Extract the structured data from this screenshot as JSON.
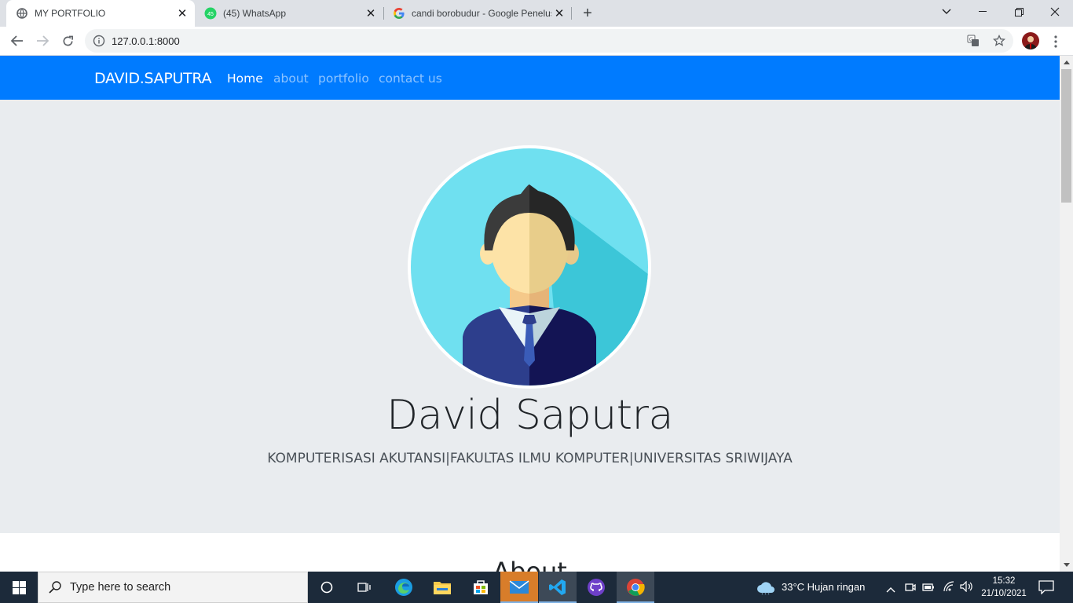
{
  "browser": {
    "tabs": [
      {
        "title": "MY PORTFOLIO",
        "favicon": "globe-icon",
        "active": true
      },
      {
        "title": "(45) WhatsApp",
        "favicon": "whatsapp-icon",
        "badge": "45",
        "active": false
      },
      {
        "title": "candi borobudur - Google Penelusuran",
        "favicon": "google-icon",
        "active": false
      }
    ],
    "url": "127.0.0.1:8000"
  },
  "navbar": {
    "brand": "DAVID.SAPUTRA",
    "links": [
      {
        "label": "Home",
        "active": true
      },
      {
        "label": "about",
        "active": false
      },
      {
        "label": "portfolio",
        "active": false
      },
      {
        "label": "contact us",
        "active": false
      }
    ]
  },
  "hero": {
    "name": "David Saputra",
    "subtitle": "KOMPUTERISASI AKUTANSI|FAKULTAS ILMU KOMPUTER|UNIVERSITAS SRIWIJAYA"
  },
  "about": {
    "title": "About"
  },
  "taskbar": {
    "search_placeholder": "Type here to search",
    "weather": "33°C  Hujan ringan",
    "time": "15:32",
    "date": "21/10/2021"
  },
  "colors": {
    "navbar": "#007bff",
    "jumbotron": "#e9ecef",
    "avatar_bg": "#6fe0f0"
  }
}
